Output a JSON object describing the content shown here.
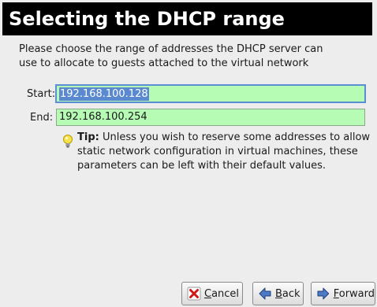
{
  "header": {
    "title": "Selecting the DHCP range"
  },
  "description": "Please choose the range of addresses the DHCP server can\nuse to allocate to guests attached to the virtual network",
  "form": {
    "start": {
      "label": "Start:",
      "value": "192.168.100.128"
    },
    "end": {
      "label": "End:",
      "value": "192.168.100.254"
    }
  },
  "tip": {
    "label": "Tip:",
    "text": " Unless you wish to reserve some addresses to allow static network configuration in virtual machines, these parameters can be left with their default values."
  },
  "buttons": {
    "cancel": {
      "mnemonic": "C",
      "rest": "ancel"
    },
    "back": {
      "mnemonic": "B",
      "rest": "ack"
    },
    "forward": {
      "mnemonic": "F",
      "rest": "orward"
    }
  },
  "colors": {
    "field_background": "#b6fcb5",
    "selection": "#5a89cf",
    "header_background": "#000000"
  }
}
